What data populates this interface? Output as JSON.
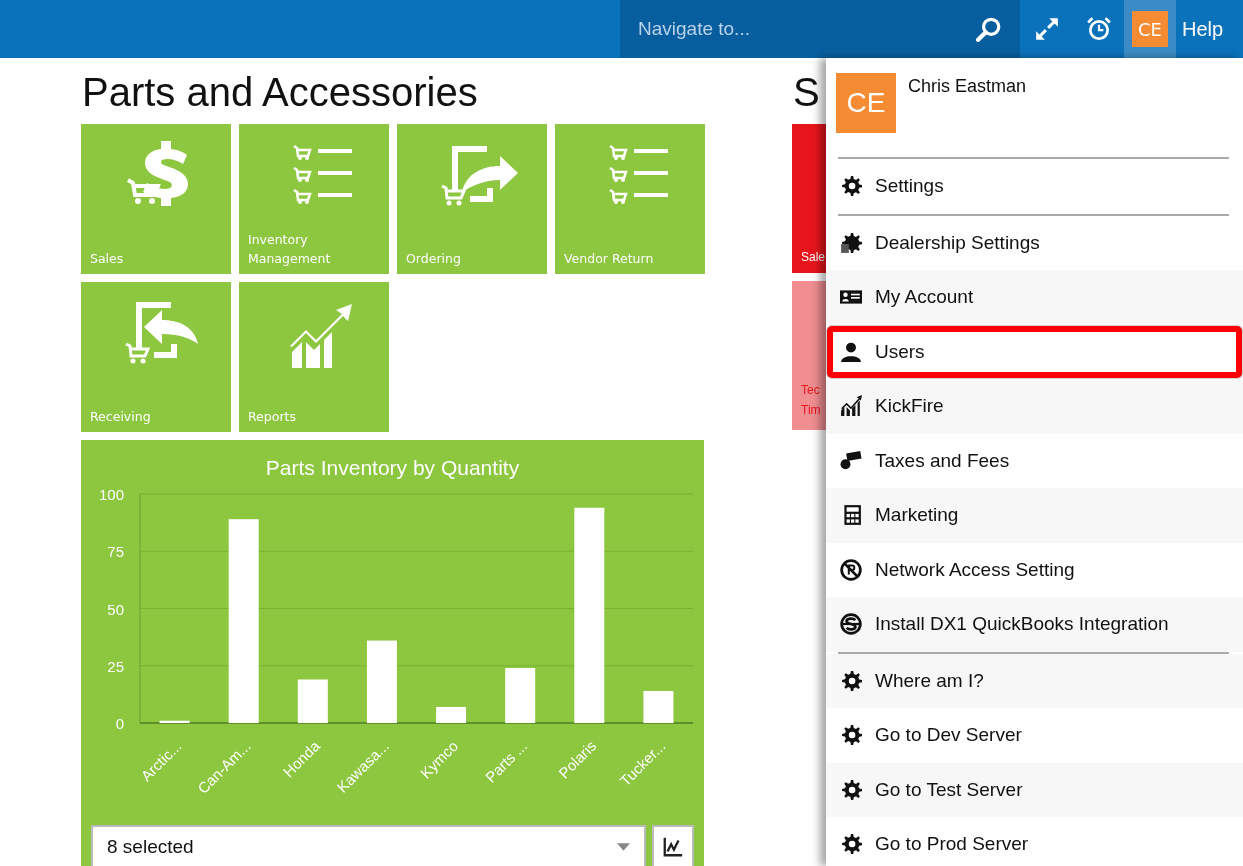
{
  "top_bar": {
    "search": {
      "placeholder": "Navigate to..."
    },
    "avatar": "CE",
    "help": "Help"
  },
  "page": {
    "title": "Parts and Accessories",
    "tiles": [
      {
        "label": "Sales",
        "kind": "sales"
      },
      {
        "label": "Inventory Management",
        "kind": "inventory"
      },
      {
        "label": "Ordering",
        "kind": "ordering"
      },
      {
        "label": "Vendor Return",
        "kind": "vendor"
      },
      {
        "label": "Receiving",
        "kind": "receiving"
      },
      {
        "label": "Reports",
        "kind": "reports"
      }
    ],
    "chart_panel": {
      "chart_data": {
        "type": "bar",
        "title": "Parts Inventory by Quantity",
        "categories": [
          "Arctic...",
          "Can-Am...",
          "Honda",
          "Kawasa...",
          "Kymco",
          "Parts ...",
          "Polaris",
          "Tucker..."
        ],
        "values": [
          1,
          89,
          19,
          36,
          7,
          24,
          94,
          14
        ],
        "ylim": [
          0,
          100
        ],
        "yticks": [
          0,
          25,
          50,
          75,
          100
        ],
        "grid": true
      },
      "filter": {
        "value": "8 selected"
      }
    }
  },
  "side_section": {
    "title": "S",
    "tiles": [
      {
        "lines": [
          "Sale"
        ],
        "color": "#e8141b"
      },
      {
        "lines": [
          "Tec",
          "Tim"
        ],
        "color": "#f08e92"
      }
    ]
  },
  "user_menu": {
    "avatar": "CE",
    "name": "Chris Eastman",
    "groups": [
      [
        {
          "label": "Settings",
          "kind": "gear",
          "highlighted": false
        }
      ],
      [
        {
          "label": "Dealership Settings",
          "kind": "dealership",
          "highlighted": false
        },
        {
          "label": "My Account",
          "kind": "id-card",
          "highlighted": false
        },
        {
          "label": "Users",
          "kind": "person",
          "highlighted": true
        },
        {
          "label": "KickFire",
          "kind": "chart",
          "highlighted": false
        },
        {
          "label": "Taxes and Fees",
          "kind": "money",
          "highlighted": false
        },
        {
          "label": "Marketing",
          "kind": "calculator",
          "highlighted": false
        },
        {
          "label": "Network Access Setting",
          "kind": "blocked",
          "highlighted": false
        },
        {
          "label": "Install DX1 QuickBooks Integration",
          "kind": "s-circle",
          "highlighted": false
        }
      ],
      [
        {
          "label": "Where am I?",
          "kind": "gear",
          "highlighted": false
        },
        {
          "label": "Go to Dev Server",
          "kind": "gear",
          "highlighted": false
        },
        {
          "label": "Go to Test Server",
          "kind": "gear",
          "highlighted": false
        },
        {
          "label": "Go to Prod Server",
          "kind": "gear",
          "highlighted": false
        }
      ]
    ]
  }
}
